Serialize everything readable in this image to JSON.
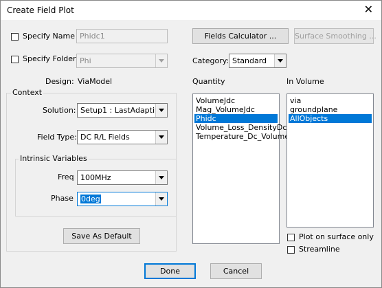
{
  "window": {
    "title": "Create Field Plot"
  },
  "specify_name": {
    "label": "Specify Name",
    "value": "Phidc1"
  },
  "specify_folder": {
    "label": "Specify Folder",
    "value": "Phi"
  },
  "buttons": {
    "fields_calculator": "Fields Calculator ...",
    "surface_smoothing": "Surface Smoothing ...",
    "save_as_default": "Save As Default",
    "done": "Done",
    "cancel": "Cancel"
  },
  "category": {
    "label": "Category:",
    "value": "Standard"
  },
  "design": {
    "label": "Design:",
    "value": "ViaModel"
  },
  "context": {
    "title": "Context",
    "solution_label": "Solution:",
    "solution_value": "Setup1 : LastAdaptive",
    "field_type_label": "Field Type:",
    "field_type_value": "DC R/L Fields",
    "intrinsic": {
      "title": "Intrinsic Variables",
      "freq_label": "Freq",
      "freq_value": "100MHz",
      "phase_label": "Phase",
      "phase_value": "0deg"
    }
  },
  "quantity": {
    "title": "Quantity",
    "items": [
      "VolumeJdc",
      "Mag_VolumeJdc",
      "Phidc",
      "Volume_Loss_DensityDc",
      "Temperature_Dc_Volume"
    ],
    "selected": "Phidc"
  },
  "in_volume": {
    "title": "In Volume",
    "items": [
      "via",
      "groundplane",
      "AllObjects"
    ],
    "selected": "AllObjects"
  },
  "options": {
    "plot_on_surface_only": "Plot on surface only",
    "streamline": "Streamline"
  },
  "icons": {
    "close": "close-icon",
    "dropdown": "chevron-down-icon"
  }
}
